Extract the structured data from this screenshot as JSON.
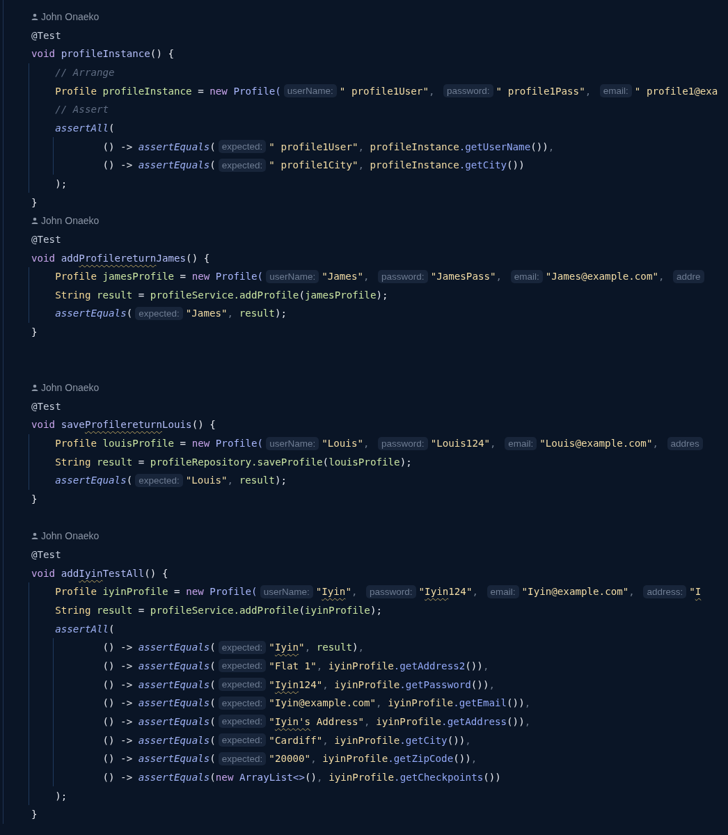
{
  "editor": {
    "lines": [
      {
        "kind": "blank"
      },
      {
        "kind": "author",
        "text": "John Onaeko"
      },
      {
        "kind": "code",
        "tokens": [
          {
            "kind": "ann",
            "text": "@Test"
          }
        ]
      },
      {
        "kind": "code",
        "tokens": [
          {
            "kind": "kw",
            "text": "void "
          },
          {
            "kind": "fn",
            "text": "profileInstance"
          },
          {
            "kind": "plain",
            "text": "() {"
          }
        ]
      },
      {
        "kind": "code",
        "tokens": [
          {
            "kind": "cmt",
            "text": "    // Arrange"
          }
        ]
      },
      {
        "kind": "code",
        "tokens": [
          {
            "kind": "type",
            "text": "    Profile "
          },
          {
            "kind": "var",
            "text": "profileInstance"
          },
          {
            "kind": "plain",
            "text": " = "
          },
          {
            "kind": "kw",
            "text": "new "
          },
          {
            "kind": "ctor",
            "text": "Profile("
          },
          {
            "kind": "hint",
            "text": "userName:"
          },
          {
            "kind": "str",
            "text": "\" profile1User\""
          },
          {
            "kind": "dim",
            "text": ", "
          },
          {
            "kind": "hint",
            "text": "password:"
          },
          {
            "kind": "str",
            "text": "\" profile1Pass\""
          },
          {
            "kind": "dim",
            "text": ", "
          },
          {
            "kind": "hint",
            "text": "email:"
          },
          {
            "kind": "str",
            "text": "\" profile1@exa"
          }
        ]
      },
      {
        "kind": "code",
        "tokens": [
          {
            "kind": "cmt",
            "text": "    // Assert"
          }
        ]
      },
      {
        "kind": "code",
        "tokens": [
          {
            "kind": "ital",
            "text": "    assertAll"
          },
          {
            "kind": "plain",
            "text": "("
          }
        ]
      },
      {
        "kind": "code",
        "tokens": [
          {
            "kind": "plain",
            "text": "            () -> "
          },
          {
            "kind": "ital",
            "text": "assertEquals"
          },
          {
            "kind": "plain",
            "text": "("
          },
          {
            "kind": "hint",
            "text": "expected:"
          },
          {
            "kind": "str",
            "text": "\" profile1User\""
          },
          {
            "kind": "dim",
            "text": ", "
          },
          {
            "kind": "ref",
            "text": "profileInstance"
          },
          {
            "kind": "call",
            "text": ".getUserName"
          },
          {
            "kind": "plain",
            "text": "())"
          },
          {
            "kind": "dim",
            "text": ","
          }
        ]
      },
      {
        "kind": "code",
        "tokens": [
          {
            "kind": "plain",
            "text": "            () -> "
          },
          {
            "kind": "ital",
            "text": "assertEquals"
          },
          {
            "kind": "plain",
            "text": "("
          },
          {
            "kind": "hint",
            "text": "expected:"
          },
          {
            "kind": "str",
            "text": "\" profile1City\""
          },
          {
            "kind": "dim",
            "text": ", "
          },
          {
            "kind": "ref",
            "text": "profileInstance"
          },
          {
            "kind": "call",
            "text": ".getCity"
          },
          {
            "kind": "plain",
            "text": "())"
          }
        ]
      },
      {
        "kind": "code",
        "tokens": [
          {
            "kind": "plain",
            "text": "    );"
          }
        ]
      },
      {
        "kind": "code",
        "tokens": [
          {
            "kind": "plain",
            "text": "}"
          }
        ]
      },
      {
        "kind": "author",
        "text": "John Onaeko"
      },
      {
        "kind": "code",
        "tokens": [
          {
            "kind": "ann",
            "text": "@Test"
          }
        ]
      },
      {
        "kind": "code",
        "tokens": [
          {
            "kind": "kw",
            "text": "void "
          },
          {
            "kind": "fn",
            "text": "add"
          },
          {
            "kind": "fnw",
            "text": "Profilereturn"
          },
          {
            "kind": "fn",
            "text": "James"
          },
          {
            "kind": "plain",
            "text": "() {"
          }
        ]
      },
      {
        "kind": "code",
        "tokens": [
          {
            "kind": "type",
            "text": "    Profile "
          },
          {
            "kind": "var",
            "text": "jamesProfile"
          },
          {
            "kind": "plain",
            "text": " = "
          },
          {
            "kind": "kw",
            "text": "new "
          },
          {
            "kind": "ctor",
            "text": "Profile("
          },
          {
            "kind": "hint",
            "text": "userName:"
          },
          {
            "kind": "str",
            "text": "\"James\""
          },
          {
            "kind": "dim",
            "text": ", "
          },
          {
            "kind": "hint",
            "text": "password:"
          },
          {
            "kind": "str",
            "text": "\"JamesPass\""
          },
          {
            "kind": "dim",
            "text": ", "
          },
          {
            "kind": "hint",
            "text": "email:"
          },
          {
            "kind": "str",
            "text": "\"James@example.com\""
          },
          {
            "kind": "dim",
            "text": ", "
          },
          {
            "kind": "hint",
            "text": "addre"
          }
        ]
      },
      {
        "kind": "code",
        "tokens": [
          {
            "kind": "type",
            "text": "    String "
          },
          {
            "kind": "var",
            "text": "result"
          },
          {
            "kind": "plain",
            "text": " = "
          },
          {
            "kind": "var",
            "text": "profileService.addProfile"
          },
          {
            "kind": "plain",
            "text": "("
          },
          {
            "kind": "var",
            "text": "jamesProfile"
          },
          {
            "kind": "plain",
            "text": ");"
          }
        ]
      },
      {
        "kind": "code",
        "tokens": [
          {
            "kind": "ital",
            "text": "    assertEquals"
          },
          {
            "kind": "plain",
            "text": "("
          },
          {
            "kind": "hint",
            "text": "expected:"
          },
          {
            "kind": "str",
            "text": "\"James\""
          },
          {
            "kind": "dim",
            "text": ", "
          },
          {
            "kind": "var",
            "text": "result"
          },
          {
            "kind": "plain",
            "text": ");"
          }
        ]
      },
      {
        "kind": "code",
        "tokens": [
          {
            "kind": "plain",
            "text": "}"
          }
        ]
      },
      {
        "kind": "blank"
      },
      {
        "kind": "blank"
      },
      {
        "kind": "author",
        "text": "John Onaeko"
      },
      {
        "kind": "code",
        "tokens": [
          {
            "kind": "ann",
            "text": "@Test"
          }
        ]
      },
      {
        "kind": "code",
        "tokens": [
          {
            "kind": "kw",
            "text": "void "
          },
          {
            "kind": "fn",
            "text": "save"
          },
          {
            "kind": "fnw",
            "text": "Profilereturn"
          },
          {
            "kind": "fn",
            "text": "Louis"
          },
          {
            "kind": "plain",
            "text": "() {"
          }
        ]
      },
      {
        "kind": "code",
        "tokens": [
          {
            "kind": "type",
            "text": "    Profile "
          },
          {
            "kind": "var",
            "text": "louisProfile"
          },
          {
            "kind": "plain",
            "text": " = "
          },
          {
            "kind": "kw",
            "text": "new "
          },
          {
            "kind": "ctor",
            "text": "Profile("
          },
          {
            "kind": "hint",
            "text": "userName:"
          },
          {
            "kind": "str",
            "text": "\"Louis\""
          },
          {
            "kind": "dim",
            "text": ", "
          },
          {
            "kind": "hint",
            "text": "password:"
          },
          {
            "kind": "str",
            "text": "\"Louis124\""
          },
          {
            "kind": "dim",
            "text": ", "
          },
          {
            "kind": "hint",
            "text": "email:"
          },
          {
            "kind": "str",
            "text": "\"Louis@example.com\""
          },
          {
            "kind": "dim",
            "text": ", "
          },
          {
            "kind": "hint",
            "text": "addres"
          }
        ]
      },
      {
        "kind": "code",
        "tokens": [
          {
            "kind": "type",
            "text": "    String "
          },
          {
            "kind": "var",
            "text": "result"
          },
          {
            "kind": "plain",
            "text": " = "
          },
          {
            "kind": "var",
            "text": "profileRepository.saveProfile"
          },
          {
            "kind": "plain",
            "text": "("
          },
          {
            "kind": "var",
            "text": "louisProfile"
          },
          {
            "kind": "plain",
            "text": ");"
          }
        ]
      },
      {
        "kind": "code",
        "tokens": [
          {
            "kind": "ital",
            "text": "    assertEquals"
          },
          {
            "kind": "plain",
            "text": "("
          },
          {
            "kind": "hint",
            "text": "expected:"
          },
          {
            "kind": "str",
            "text": "\"Louis\""
          },
          {
            "kind": "dim",
            "text": ", "
          },
          {
            "kind": "var",
            "text": "result"
          },
          {
            "kind": "plain",
            "text": ");"
          }
        ]
      },
      {
        "kind": "code",
        "tokens": [
          {
            "kind": "plain",
            "text": "}"
          }
        ]
      },
      {
        "kind": "blank"
      },
      {
        "kind": "author",
        "text": "John Onaeko"
      },
      {
        "kind": "code",
        "tokens": [
          {
            "kind": "ann",
            "text": "@Test"
          }
        ]
      },
      {
        "kind": "code",
        "tokens": [
          {
            "kind": "kw",
            "text": "void "
          },
          {
            "kind": "fn",
            "text": "add"
          },
          {
            "kind": "fnw",
            "text": "Iyin"
          },
          {
            "kind": "fn",
            "text": "TestAll"
          },
          {
            "kind": "plain",
            "text": "() {"
          }
        ]
      },
      {
        "kind": "code",
        "tokens": [
          {
            "kind": "type",
            "text": "    Profile "
          },
          {
            "kind": "var",
            "text": "iyinProfile"
          },
          {
            "kind": "plain",
            "text": " = "
          },
          {
            "kind": "kw",
            "text": "new "
          },
          {
            "kind": "ctor",
            "text": "Profile("
          },
          {
            "kind": "hint",
            "text": "userName:"
          },
          {
            "kind": "str",
            "text": "\""
          },
          {
            "kind": "strw",
            "text": "Iyin"
          },
          {
            "kind": "str",
            "text": "\""
          },
          {
            "kind": "dim",
            "text": ", "
          },
          {
            "kind": "hint",
            "text": "password:"
          },
          {
            "kind": "str",
            "text": "\""
          },
          {
            "kind": "strw",
            "text": "Iyin"
          },
          {
            "kind": "str",
            "text": "124\""
          },
          {
            "kind": "dim",
            "text": ", "
          },
          {
            "kind": "hint",
            "text": "email:"
          },
          {
            "kind": "str",
            "text": "\"Iyin@example.com\""
          },
          {
            "kind": "dim",
            "text": ", "
          },
          {
            "kind": "hint",
            "text": "address:"
          },
          {
            "kind": "str",
            "text": "\""
          },
          {
            "kind": "strw",
            "text": "I"
          }
        ]
      },
      {
        "kind": "code",
        "tokens": [
          {
            "kind": "type",
            "text": "    String "
          },
          {
            "kind": "var",
            "text": "result"
          },
          {
            "kind": "plain",
            "text": " = "
          },
          {
            "kind": "var",
            "text": "profileService.addProfile"
          },
          {
            "kind": "plain",
            "text": "("
          },
          {
            "kind": "var",
            "text": "iyinProfile"
          },
          {
            "kind": "plain",
            "text": ");"
          }
        ]
      },
      {
        "kind": "code",
        "tokens": [
          {
            "kind": "ital",
            "text": "    assertAll"
          },
          {
            "kind": "plain",
            "text": "("
          }
        ]
      },
      {
        "kind": "code",
        "tokens": [
          {
            "kind": "plain",
            "text": "            () -> "
          },
          {
            "kind": "ital",
            "text": "assertEquals"
          },
          {
            "kind": "plain",
            "text": "("
          },
          {
            "kind": "hint",
            "text": "expected:"
          },
          {
            "kind": "str",
            "text": "\""
          },
          {
            "kind": "strw",
            "text": "Iyin"
          },
          {
            "kind": "str",
            "text": "\""
          },
          {
            "kind": "dim",
            "text": ", "
          },
          {
            "kind": "var",
            "text": "result"
          },
          {
            "kind": "plain",
            "text": ")"
          },
          {
            "kind": "dim",
            "text": ","
          }
        ]
      },
      {
        "kind": "code",
        "tokens": [
          {
            "kind": "plain",
            "text": "            () -> "
          },
          {
            "kind": "ital",
            "text": "assertEquals"
          },
          {
            "kind": "plain",
            "text": "("
          },
          {
            "kind": "hint",
            "text": "expected:"
          },
          {
            "kind": "str",
            "text": "\"Flat 1\""
          },
          {
            "kind": "dim",
            "text": ", "
          },
          {
            "kind": "ref",
            "text": "iyinProfile"
          },
          {
            "kind": "call",
            "text": ".getAddress2"
          },
          {
            "kind": "plain",
            "text": "())"
          },
          {
            "kind": "dim",
            "text": ","
          }
        ]
      },
      {
        "kind": "code",
        "tokens": [
          {
            "kind": "plain",
            "text": "            () -> "
          },
          {
            "kind": "ital",
            "text": "assertEquals"
          },
          {
            "kind": "plain",
            "text": "("
          },
          {
            "kind": "hint",
            "text": "expected:"
          },
          {
            "kind": "str",
            "text": "\""
          },
          {
            "kind": "strw",
            "text": "Iyin"
          },
          {
            "kind": "str",
            "text": "124\""
          },
          {
            "kind": "dim",
            "text": ", "
          },
          {
            "kind": "ref",
            "text": "iyinProfile"
          },
          {
            "kind": "call",
            "text": ".getPassword"
          },
          {
            "kind": "plain",
            "text": "())"
          },
          {
            "kind": "dim",
            "text": ","
          }
        ]
      },
      {
        "kind": "code",
        "tokens": [
          {
            "kind": "plain",
            "text": "            () -> "
          },
          {
            "kind": "ital",
            "text": "assertEquals"
          },
          {
            "kind": "plain",
            "text": "("
          },
          {
            "kind": "hint",
            "text": "expected:"
          },
          {
            "kind": "str",
            "text": "\"Iyin@example.com\""
          },
          {
            "kind": "dim",
            "text": ", "
          },
          {
            "kind": "ref",
            "text": "iyinProfile"
          },
          {
            "kind": "call",
            "text": ".getEmail"
          },
          {
            "kind": "plain",
            "text": "())"
          },
          {
            "kind": "dim",
            "text": ","
          }
        ]
      },
      {
        "kind": "code",
        "tokens": [
          {
            "kind": "plain",
            "text": "            () -> "
          },
          {
            "kind": "ital",
            "text": "assertEquals"
          },
          {
            "kind": "plain",
            "text": "("
          },
          {
            "kind": "hint",
            "text": "expected:"
          },
          {
            "kind": "str",
            "text": "\""
          },
          {
            "kind": "strw",
            "text": "Iyin's"
          },
          {
            "kind": "str",
            "text": " Address\""
          },
          {
            "kind": "dim",
            "text": ", "
          },
          {
            "kind": "ref",
            "text": "iyinProfile"
          },
          {
            "kind": "call",
            "text": ".getAddress"
          },
          {
            "kind": "plain",
            "text": "())"
          },
          {
            "kind": "dim",
            "text": ","
          }
        ]
      },
      {
        "kind": "code",
        "tokens": [
          {
            "kind": "plain",
            "text": "            () -> "
          },
          {
            "kind": "ital",
            "text": "assertEquals"
          },
          {
            "kind": "plain",
            "text": "("
          },
          {
            "kind": "hint",
            "text": "expected:"
          },
          {
            "kind": "str",
            "text": "\"Cardiff\""
          },
          {
            "kind": "dim",
            "text": ", "
          },
          {
            "kind": "ref",
            "text": "iyinProfile"
          },
          {
            "kind": "call",
            "text": ".getCity"
          },
          {
            "kind": "plain",
            "text": "())"
          },
          {
            "kind": "dim",
            "text": ","
          }
        ]
      },
      {
        "kind": "code",
        "tokens": [
          {
            "kind": "plain",
            "text": "            () -> "
          },
          {
            "kind": "ital",
            "text": "assertEquals"
          },
          {
            "kind": "plain",
            "text": "("
          },
          {
            "kind": "hint",
            "text": "expected:"
          },
          {
            "kind": "str",
            "text": "\"20000\""
          },
          {
            "kind": "dim",
            "text": ", "
          },
          {
            "kind": "ref",
            "text": "iyinProfile"
          },
          {
            "kind": "call",
            "text": ".getZipCode"
          },
          {
            "kind": "plain",
            "text": "())"
          },
          {
            "kind": "dim",
            "text": ","
          }
        ]
      },
      {
        "kind": "code",
        "tokens": [
          {
            "kind": "plain",
            "text": "            () -> "
          },
          {
            "kind": "ital",
            "text": "assertEquals"
          },
          {
            "kind": "plain",
            "text": "("
          },
          {
            "kind": "kw",
            "text": "new "
          },
          {
            "kind": "ctor",
            "text": "ArrayList<>"
          },
          {
            "kind": "plain",
            "text": "()"
          },
          {
            "kind": "dim",
            "text": ", "
          },
          {
            "kind": "ref",
            "text": "iyinProfile"
          },
          {
            "kind": "call",
            "text": ".getCheckpoints"
          },
          {
            "kind": "plain",
            "text": "())"
          }
        ]
      },
      {
        "kind": "code",
        "tokens": [
          {
            "kind": "plain",
            "text": "    );"
          }
        ]
      },
      {
        "kind": "code",
        "tokens": [
          {
            "kind": "plain",
            "text": "}"
          }
        ]
      }
    ]
  }
}
